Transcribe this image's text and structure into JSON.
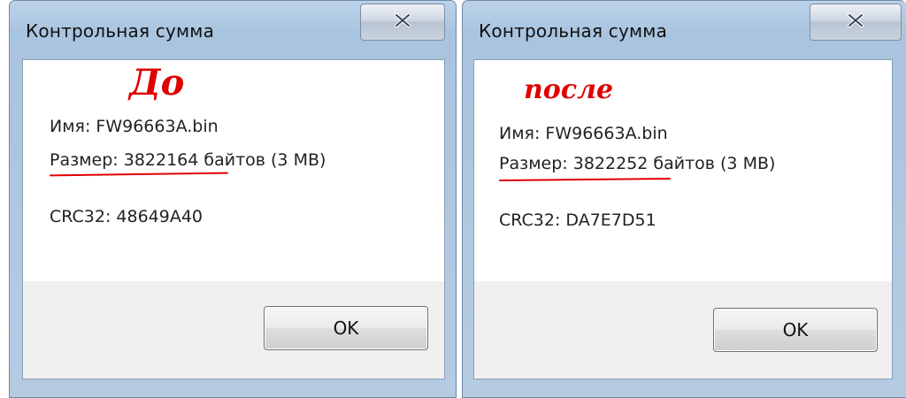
{
  "left_dialog": {
    "title": "Контрольная сумма",
    "handwritten_note": "До",
    "name_line": "Имя: FW96663A.bin",
    "size_line": "Размер: 3822164 байтов (3 MB)",
    "crc_line": "CRC32: 48649A40",
    "ok_label": "OK"
  },
  "right_dialog": {
    "title": "Контрольная сумма",
    "handwritten_note": "после",
    "name_line": "Имя: FW96663A.bin",
    "size_line": "Размер: 3822252 байтов (3 MB)",
    "crc_line": "CRC32: DA7E7D51",
    "ok_label": "OK"
  },
  "colors": {
    "annotation": "#e00000",
    "titlebar": "#b5cbe2"
  },
  "icons": [
    "close-icon"
  ]
}
